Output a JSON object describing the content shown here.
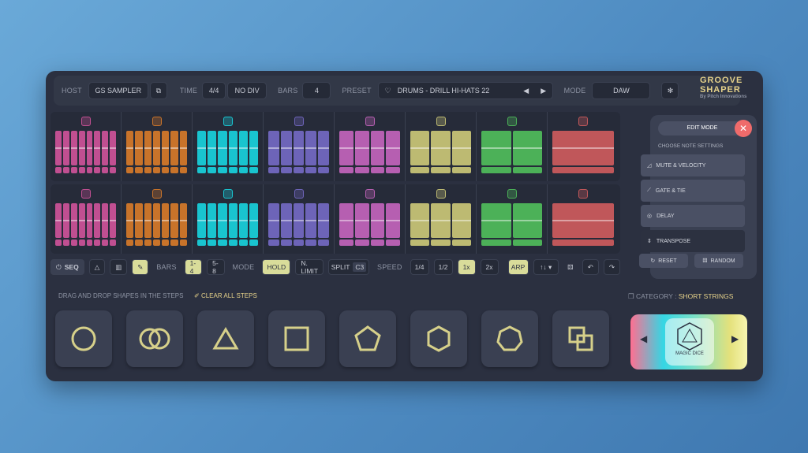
{
  "top": {
    "host_label": "HOST",
    "host_value": "GS SAMPLER",
    "time_label": "TIME",
    "time_sig": "4/4",
    "time_div": "NO DIV",
    "bars_label": "BARS",
    "bars_value": "4",
    "preset_label": "PRESET",
    "preset_value": "DRUMS - DRILL HI-HATS 22",
    "mode_label": "MODE",
    "mode_value": "DAW"
  },
  "logo": {
    "line1": "GROOVE",
    "line2": "SHAPER",
    "line3": "By Pitch Innovations"
  },
  "side": {
    "edit_mode": "EDIT MODE",
    "choose": "CHOOSE NOTE SETTINGS",
    "options": [
      "MUTE & VELOCITY",
      "GATE & TIE",
      "DELAY",
      "TRANSPOSE"
    ],
    "reset": "RESET",
    "random": "RANDOM"
  },
  "controls": {
    "seq": "SEQ",
    "bars_label": "BARS",
    "bars_a": "1-4",
    "bars_b": "5-8",
    "mode_label": "MODE",
    "hold": "HOLD",
    "nlimit": "N. LIMIT",
    "split": "SPLIT",
    "split_note": "C3",
    "speed_label": "SPEED",
    "speeds": [
      "1/4",
      "1/2",
      "1x",
      "2x"
    ],
    "arp": "ARP"
  },
  "bottom": {
    "drag_text": "DRAG AND DROP SHAPES IN THE STEPS",
    "clear_text": "CLEAR ALL STEPS",
    "category_label": "CATEGORY : ",
    "category_value": "SHORT STRINGS",
    "dice_label": "MAGIC DICE"
  },
  "colors": {
    "pink": "#c04f91",
    "orange": "#c8732a",
    "cyan": "#19c4cf",
    "purple": "#6d64b8",
    "magenta": "#b65fb1",
    "olive": "#bdba72",
    "green": "#4cb158",
    "salmon": "#c0575a",
    "accent": "#e6d28a"
  },
  "segments": [
    {
      "color": "#c04f91",
      "steps": 8,
      "icon": "squares-icon"
    },
    {
      "color": "#c8732a",
      "steps": 7,
      "icon": "heptagon-icon"
    },
    {
      "color": "#19c4cf",
      "steps": 6,
      "icon": "hexagon-icon"
    },
    {
      "color": "#6d64b8",
      "steps": 5,
      "icon": "pentagon-icon"
    },
    {
      "color": "#b65fb1",
      "steps": 4,
      "icon": "square-icon"
    },
    {
      "color": "#bdba72",
      "steps": 3,
      "icon": "triangle-icon"
    },
    {
      "color": "#4cb158",
      "steps": 2,
      "icon": "two-circles-icon"
    },
    {
      "color": "#c0575a",
      "steps": 1,
      "icon": "circle-icon"
    }
  ]
}
